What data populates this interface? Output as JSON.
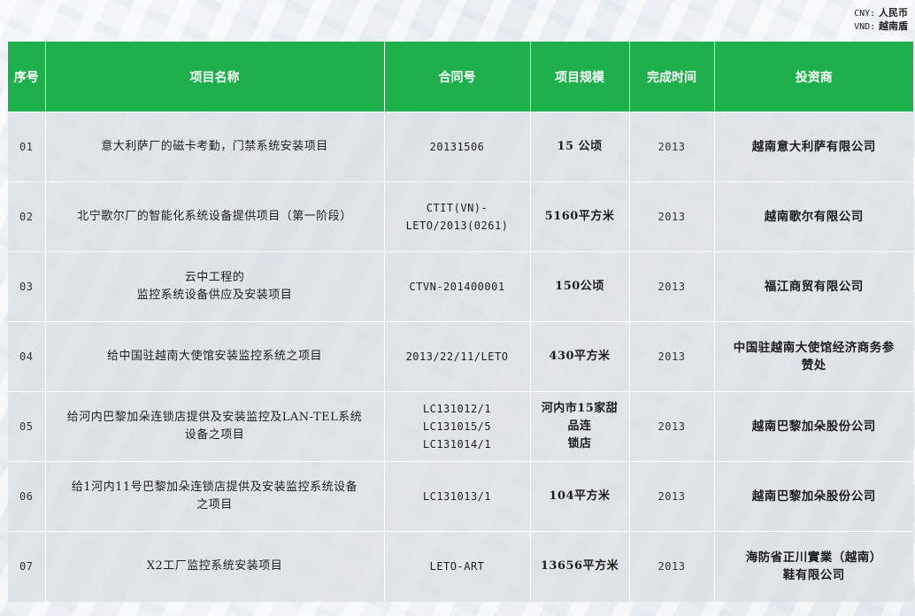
{
  "currency_note": {
    "cny_code": "CNY:",
    "cny_label": "人民币",
    "vnd_code": "VND:",
    "vnd_label": "越南盾"
  },
  "table": {
    "headers": [
      "序号",
      "项目名称",
      "合同号",
      "项目规模",
      "完成时间",
      "投资商"
    ],
    "rows": [
      {
        "no": "01",
        "name": [
          "意大利萨厂的磁卡考勤，门禁系统安装项目"
        ],
        "contract": [
          "20131506"
        ],
        "scale": [
          "15 公顷"
        ],
        "year": "2013",
        "investor": [
          "越南意大利萨有限公司"
        ]
      },
      {
        "no": "02",
        "name": [
          "北宁歌尔厂的智能化系统设备提供项目（第一阶段）"
        ],
        "contract": [
          "CTIT(VN)-",
          "LETO/2013(0261)"
        ],
        "scale": [
          "5160平方米"
        ],
        "year": "2013",
        "investor": [
          "越南歌尔有限公司"
        ]
      },
      {
        "no": "03",
        "name": [
          "云中工程的",
          "监控系统设备供应及安装项目"
        ],
        "contract": [
          "CTVN-201400001"
        ],
        "scale": [
          "150公顷"
        ],
        "year": "2013",
        "investor": [
          "福江商贸有限公司"
        ]
      },
      {
        "no": "04",
        "name": [
          "给中国驻越南大使馆安装监控系统之项目"
        ],
        "contract": [
          "2013/22/11/LETO"
        ],
        "scale": [
          "430平方米"
        ],
        "year": "2013",
        "investor": [
          "中国驻越南大使馆经济商务参",
          "赞处"
        ]
      },
      {
        "no": "05",
        "name": [
          "给河内巴黎加朵连锁店提供及安装监控及LAN-TEL系统",
          "设备之项目"
        ],
        "contract": [
          "LC131012/1",
          "LC131015/5",
          "LC131014/1"
        ],
        "scale": [
          "河内市15家甜品连",
          "锁店"
        ],
        "year": "2013",
        "investor": [
          "越南巴黎加朵股份公司"
        ]
      },
      {
        "no": "06",
        "name": [
          "给1河内11号巴黎加朵连锁店提供及安装监控系统设备",
          "之项目"
        ],
        "contract": [
          "LC131013/1"
        ],
        "scale": [
          "104平方米"
        ],
        "year": "2013",
        "investor": [
          "越南巴黎加朵股份公司"
        ]
      },
      {
        "no": "07",
        "name": [
          "X2工厂监控系统安装项目"
        ],
        "contract": [
          "LETO-ART"
        ],
        "scale": [
          "13656平方米"
        ],
        "year": "2013",
        "investor": [
          "海防省正川實業（越南）",
          "鞋有限公司"
        ]
      }
    ]
  }
}
